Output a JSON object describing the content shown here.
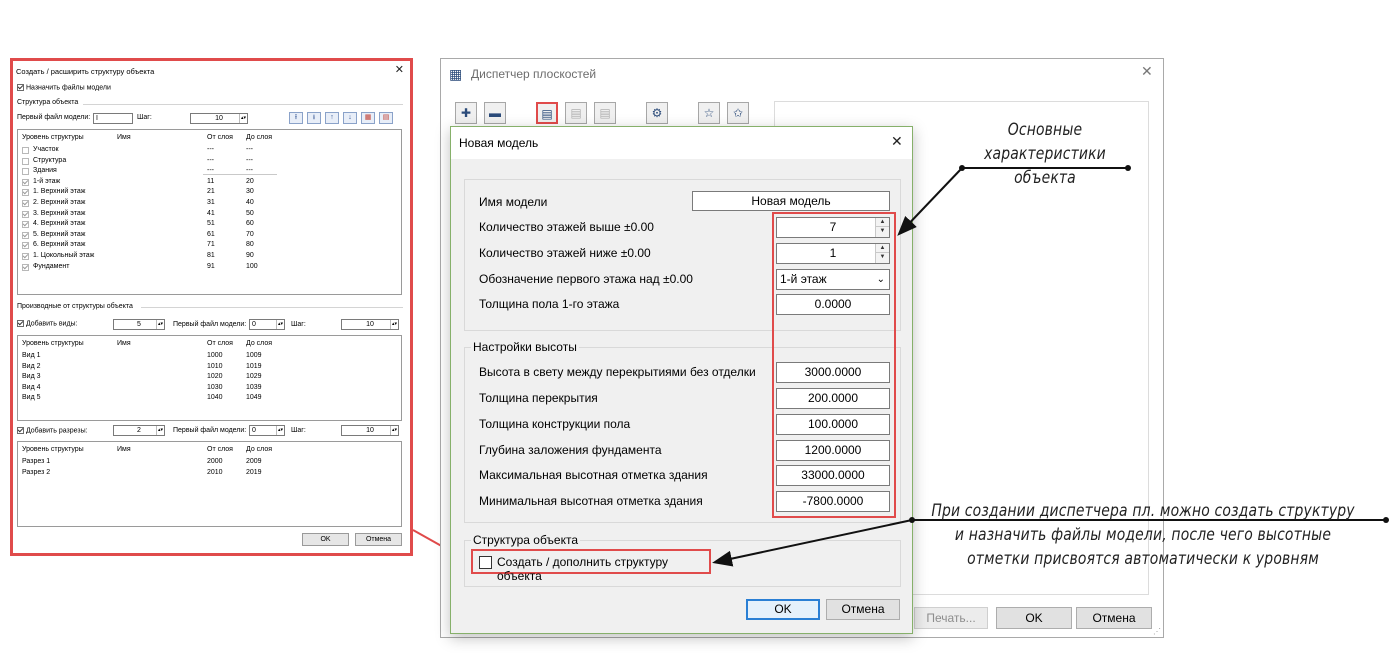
{
  "left_dialog": {
    "title": "Создать / расширить структуру объекта",
    "assign_models_label": "Назначить файлы модели",
    "structure_section": "Структура объекта",
    "first_model_file_label": "Первый файл модели:",
    "first_model_file_value": "I",
    "step_label": "Шаг:",
    "step_value": "10",
    "structure_columns": [
      "Уровень структуры",
      "Имя",
      "От слоя",
      "До слоя"
    ],
    "structure_rows": [
      {
        "level": "Участок",
        "from": "---",
        "to": "---",
        "checked": false
      },
      {
        "level": "Структура",
        "from": "---",
        "to": "---",
        "checked": false
      },
      {
        "level": "Здания",
        "from": "---",
        "to": "---",
        "checked": false
      },
      {
        "level": "1-й этаж",
        "from": "11",
        "to": "20",
        "checked": true
      },
      {
        "level": "1. Верхний этаж",
        "from": "21",
        "to": "30",
        "checked": true
      },
      {
        "level": "2. Верхний этаж",
        "from": "31",
        "to": "40",
        "checked": true
      },
      {
        "level": "3. Верхний этаж",
        "from": "41",
        "to": "50",
        "checked": true
      },
      {
        "level": "4. Верхний этаж",
        "from": "51",
        "to": "60",
        "checked": true
      },
      {
        "level": "5. Верхний этаж",
        "from": "61",
        "to": "70",
        "checked": true
      },
      {
        "level": "6. Верхний этаж",
        "from": "71",
        "to": "80",
        "checked": true
      },
      {
        "level": "1. Цокольный этаж",
        "from": "81",
        "to": "90",
        "checked": true
      },
      {
        "level": "Фундамент",
        "from": "91",
        "to": "100",
        "checked": true
      }
    ],
    "derived_section": "Производные от структуры объекта",
    "add_views_label": "Добавить виды:",
    "add_views_value": "5",
    "views_first_file_label": "Первый файл модели:",
    "views_first_file_value": "0",
    "views_step_label": "Шаг:",
    "views_step_value": "10",
    "views_columns": [
      "Уровень структуры",
      "Имя",
      "От слоя",
      "До слоя"
    ],
    "views_rows": [
      {
        "level": "Вид 1",
        "from": "1000",
        "to": "1009"
      },
      {
        "level": "Вид 2",
        "from": "1010",
        "to": "1019"
      },
      {
        "level": "Вид 3",
        "from": "1020",
        "to": "1029"
      },
      {
        "level": "Вид 4",
        "from": "1030",
        "to": "1039"
      },
      {
        "level": "Вид 5",
        "from": "1040",
        "to": "1049"
      }
    ],
    "add_sections_label": "Добавить разрезы:",
    "add_sections_value": "2",
    "sections_first_file_label": "Первый файл модели:",
    "sections_first_file_value": "0",
    "sections_step_label": "Шаг:",
    "sections_step_value": "10",
    "sections_columns": [
      "Уровень структуры",
      "Имя",
      "От слоя",
      "До слоя"
    ],
    "sections_rows": [
      {
        "level": "Разрез 1",
        "from": "2000",
        "to": "2009"
      },
      {
        "level": "Разрез 2",
        "from": "2010",
        "to": "2019"
      }
    ],
    "ok_label": "OK",
    "cancel_label": "Отмена"
  },
  "back_dialog": {
    "title": "Диспетчер плоскостей",
    "print_label": "Печать...",
    "ok_label": "OK",
    "cancel_label": "Отмена"
  },
  "front_dialog": {
    "title": "Новая модель",
    "model_name_label": "Имя модели",
    "model_name_value": "Новая модель",
    "floors_above_label": "Количество этажей выше ±0.00",
    "floors_above_value": "7",
    "floors_below_label": "Количество этажей ниже ±0.00",
    "floors_below_value": "1",
    "first_floor_label": "Обозначение первого этажа над ±0.00",
    "first_floor_value": "1-й этаж",
    "floor_thickness_label": "Толщина пола 1-го этажа",
    "floor_thickness_value": "0.0000",
    "height_section": "Настройки высоты",
    "clear_height_label": "Высота в свету между перекрытиями без отделки",
    "clear_height_value": "3000.0000",
    "slab_thickness_label": "Толщина перекрытия",
    "slab_thickness_value": "200.0000",
    "floor_construction_label": "Толщина конструкции пола",
    "floor_construction_value": "100.0000",
    "foundation_depth_label": "Глубина заложения фундамента",
    "foundation_depth_value": "1200.0000",
    "max_elevation_label": "Максимальная высотная отметка здания",
    "max_elevation_value": "33000.0000",
    "min_elevation_label": "Минимальная высотная отметка здания",
    "min_elevation_value": "-7800.0000",
    "structure_section": "Структура объекта",
    "create_structure_label": "Создать / дополнить структуру объекта",
    "ok_label": "OK",
    "cancel_label": "Отмена"
  },
  "annotations": {
    "main_characteristics": [
      "Основные",
      "характеристики",
      "объекта"
    ],
    "note": [
      "При создании диспетчера пл. можно создать структуру",
      "и назначить файлы модели, после чего высотные",
      "отметки присвоятся автоматически к уровням"
    ]
  },
  "colors": {
    "highlight_red": "#e04b4b",
    "dialog_border_green": "#86b06a",
    "toolbar_blue": "#2b4b7a"
  }
}
